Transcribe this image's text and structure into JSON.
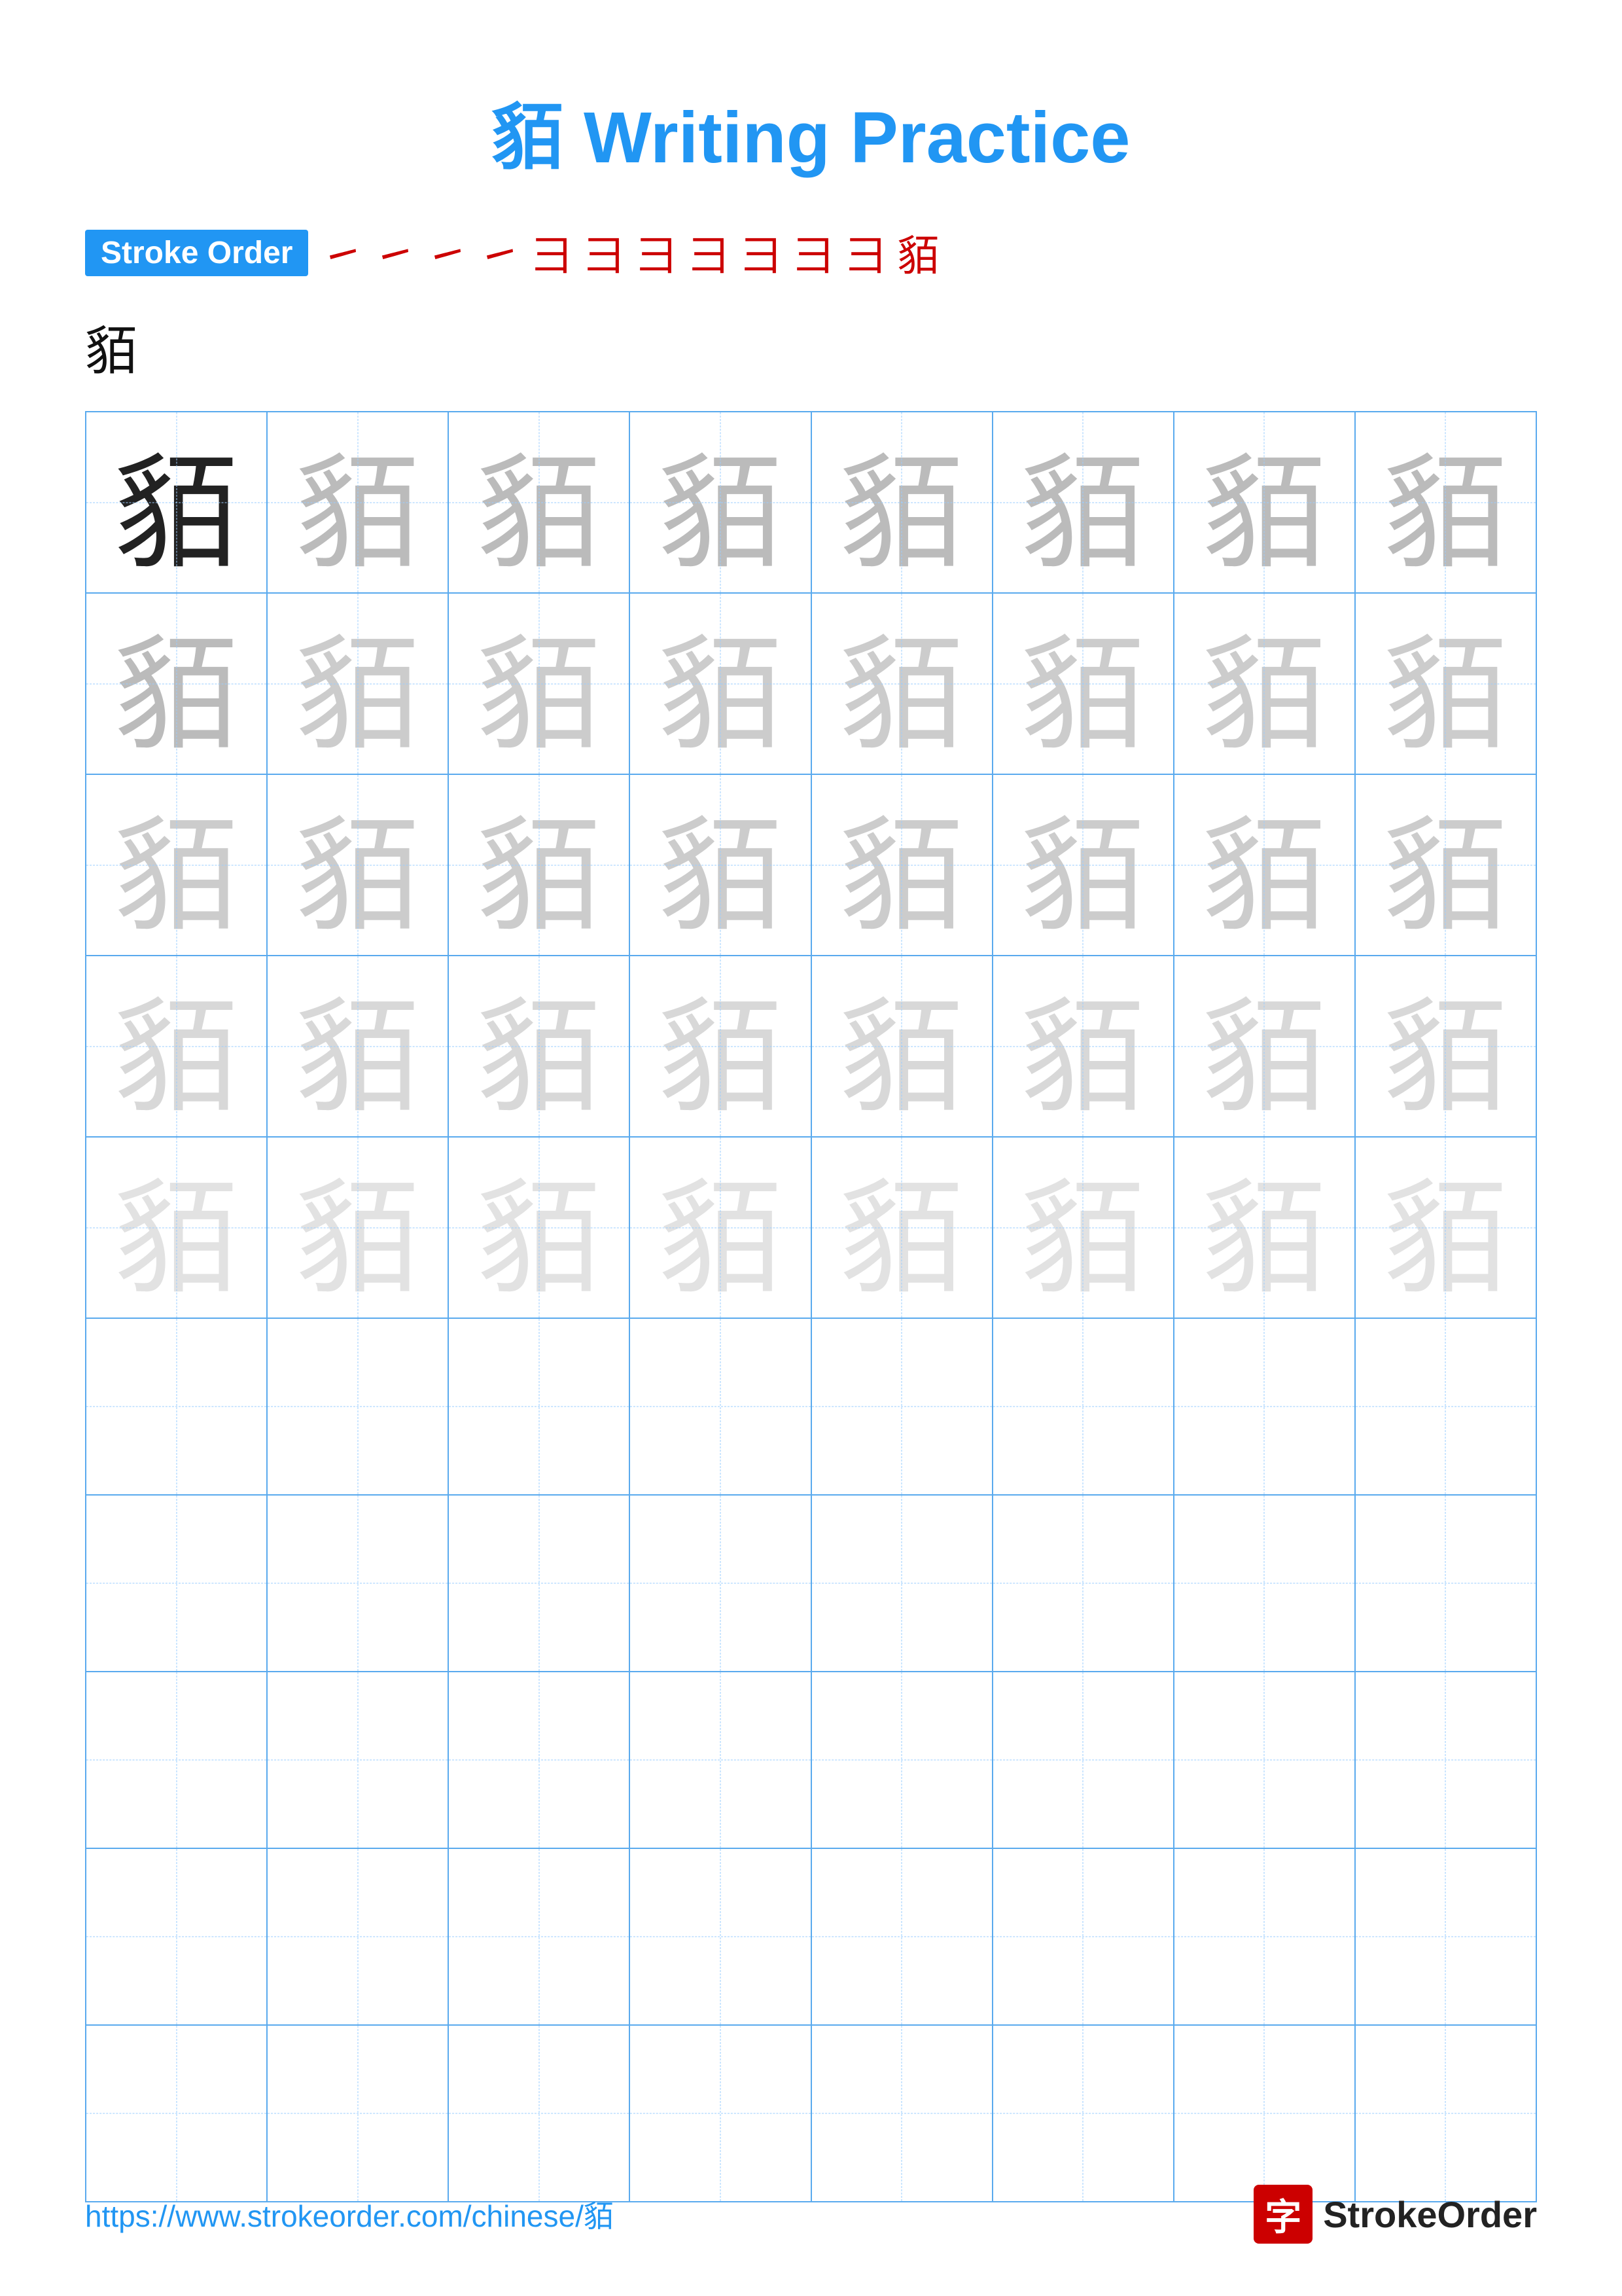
{
  "page": {
    "title": "貊 Writing Practice",
    "character": "貊",
    "stroke_order_label": "Stroke Order",
    "stroke_sequence": [
      "㇀",
      "㇀",
      "㇀",
      "㇀",
      "⺕",
      "⺕",
      "⺕",
      "⺕",
      "⺕",
      "⺕",
      "⺕",
      "貊"
    ],
    "url": "https://www.strokeorder.com/chinese/貊",
    "logo_char": "字",
    "logo_text": "StrokeOrder"
  },
  "grid": {
    "rows": 10,
    "cols": 8,
    "char": "貊",
    "shade_pattern": [
      [
        "dark",
        "gray1",
        "gray1",
        "gray1",
        "gray1",
        "gray1",
        "gray1",
        "gray1"
      ],
      [
        "gray1",
        "gray2",
        "gray2",
        "gray2",
        "gray2",
        "gray2",
        "gray2",
        "gray2"
      ],
      [
        "gray2",
        "gray2",
        "gray2",
        "gray2",
        "gray2",
        "gray2",
        "gray2",
        "gray2"
      ],
      [
        "gray3",
        "gray3",
        "gray3",
        "gray3",
        "gray3",
        "gray3",
        "gray3",
        "gray3"
      ],
      [
        "gray4",
        "gray4",
        "gray4",
        "gray4",
        "gray4",
        "gray4",
        "gray4",
        "gray4"
      ],
      [
        "empty",
        "empty",
        "empty",
        "empty",
        "empty",
        "empty",
        "empty",
        "empty"
      ],
      [
        "empty",
        "empty",
        "empty",
        "empty",
        "empty",
        "empty",
        "empty",
        "empty"
      ],
      [
        "empty",
        "empty",
        "empty",
        "empty",
        "empty",
        "empty",
        "empty",
        "empty"
      ],
      [
        "empty",
        "empty",
        "empty",
        "empty",
        "empty",
        "empty",
        "empty",
        "empty"
      ],
      [
        "empty",
        "empty",
        "empty",
        "empty",
        "empty",
        "empty",
        "empty",
        "empty"
      ]
    ]
  }
}
